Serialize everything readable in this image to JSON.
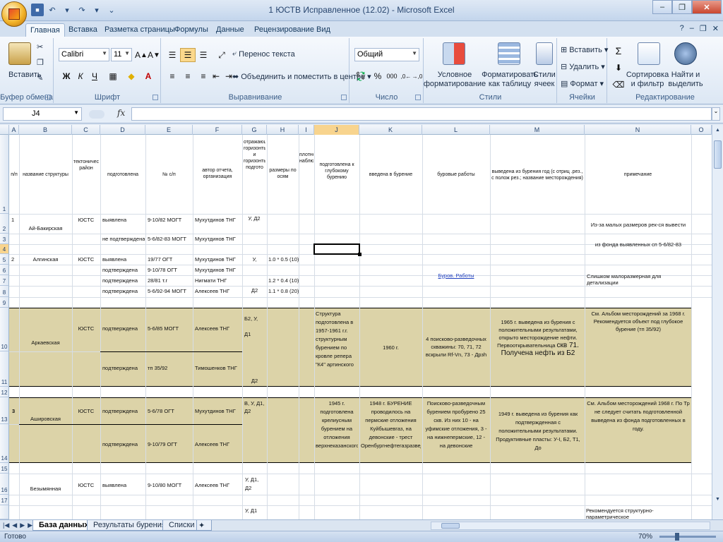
{
  "window": {
    "title": "1 ЮСТВ Исправленное (12.02) - Microsoft Excel"
  },
  "ribbon_tabs": [
    "Главная",
    "Вставка",
    "Разметка страницы",
    "Формулы",
    "Данные",
    "Рецензирование",
    "Вид"
  ],
  "ribbon": {
    "clipboard": {
      "label": "Буфер обмена",
      "paste": "Вставить"
    },
    "font": {
      "label": "Шрифт",
      "name": "Calibri",
      "size": "11",
      "bold": "Ж",
      "italic": "К",
      "underline": "Ч"
    },
    "alignment": {
      "label": "Выравнивание",
      "wrap": "Перенос текста",
      "merge": "Объединить и поместить в центре"
    },
    "number": {
      "label": "Число",
      "format": "Общий",
      "percent": "%",
      "thousands": "000"
    },
    "styles": {
      "label": "Стили",
      "conditional": "Условное форматирование",
      "as_table": "Форматировать как таблицу",
      "cell_styles": "Стили ячеек"
    },
    "cells": {
      "label": "Ячейки",
      "insert": "Вставить",
      "delete": "Удалить",
      "format": "Формат"
    },
    "editing": {
      "label": "Редактирование",
      "sort": "Сортировка и фильтр",
      "find": "Найти и выделить"
    }
  },
  "formula_bar": {
    "name_box": "J4",
    "fx": "fx",
    "value": ""
  },
  "columns": [
    "A",
    "B",
    "C",
    "D",
    "E",
    "F",
    "G",
    "H",
    "I",
    "J",
    "K",
    "L",
    "M",
    "N",
    "O"
  ],
  "rows": [
    "1",
    "2",
    "3",
    "4",
    "5",
    "6",
    "7",
    "8",
    "9",
    "10",
    "11",
    "12",
    "13",
    "14",
    "15",
    "16",
    "17"
  ],
  "headers": {
    "a": "п/п",
    "b": "название структуры",
    "c": "тектонический район",
    "d": "подготовлена",
    "e": "№ с/п",
    "f": "автор отчета, организация",
    "g": "отражающие горизонты и горизонты подгото",
    "h": "размеры по осям",
    "i": "плотность наблюдений",
    "j": "подготовлена к глубокому бурению",
    "k": "введена в бурение",
    "l": "буровые работы",
    "m": "выведена из бурения год (с отриц .рез., с полож рез.; название месторождения)",
    "n": "примечание"
  },
  "cells": {
    "r2_a": "1",
    "r2_b": "Ай-Бакирская",
    "r2_c": "ЮСТС",
    "r2_d": "выявлена",
    "r2_e": "9-10/82 МОГТ",
    "r2_f": "Мухутдинов ТНГ",
    "r2_g": "У, Д2",
    "r2_n": "Из-за малых размеров рек-ся вывести из фонда выявленных сп 5-6/82-83",
    "r3_d": "не подтверждена",
    "r3_e": "5-6/82-83 МОГТ",
    "r3_f": "Мухутдинов ТНГ",
    "r5_a": "2",
    "r5_b": "Алгинская",
    "r5_c": "ЮСТС",
    "r5_d": "выявлена",
    "r5_e": "19/77 ОГТ",
    "r5_f": "Мухутдинов ТНГ",
    "r5_g": "У,",
    "r5_h": "1.0 * 0.5 (10)",
    "r6_d": "подтверждена",
    "r6_e": "9-10/78 ОГТ",
    "r6_f": "Мухутдинов ТНГ",
    "r6_l": "Буров. Работы",
    "r7_d": "подтверждена",
    "r7_e": "28/81 т.г",
    "r7_f": "Нигмати ТНГ",
    "r7_g": "Д2",
    "r7_h": "1.2 * 0.4 (10)",
    "r8_d": "подтверждена",
    "r8_e": "5-6/92-94 МОГТ",
    "r8_f": "Алексеев ТНГ",
    "r8_h": "1.1 * 0.8 (20)",
    "r6_n": "Слишком малоразмерная для детализации",
    "r10_b": "Аркаевская",
    "r10_c": "ЮСТС",
    "r10_d": "подтверждена",
    "r10_e": "5-6/85 МОГТ",
    "r10_f": "Алексеев ТНГ",
    "r10_g": "Б2, У, Д1",
    "r10_j": "Структура подготовлена в 1957-1961 г.г. структурным бурением по кровле репера \"К4\" артинского",
    "r10_k": "1960 г.",
    "r10_l": "4 поисково-разведочных скважины: 70, 71, 72 вскрыли Rf-Vn, 73 - Дрзh",
    "r10_m": "1965 г. выведена из бурения с положительными результатами, открыто месторождение нефти. Первооткрывательница",
    "r10_m_well": "скв 71.",
    "r10_m_oil": "Получена нефть из Б2",
    "r10_n": "См. Альбом месторождений за 1968 г. Рекомендуется объект под глубокое бурение (тп 35/92)",
    "r11_d": "подтверждена",
    "r11_e": "тп 35/92",
    "r11_f": "Тимошенков ТНГ",
    "r11_g": "Д2",
    "r13_a": "3",
    "r13_b": "Аширoвская",
    "r13_c": "ЮСТС",
    "r13_d": "подтверждена",
    "r13_e": "5-6/78 ОГТ",
    "r13_f": "Мухутдинов ТНГ",
    "r13_g": "В, У, Д1, Д2",
    "r13_j": "1945 г. подготовлена крелиусным бурением на отложения верхнеказанского",
    "r13_k": "1948 г. БУРЕНИЕ проводилось на пермские отложения Куйбышевгаз, на девонские - трест Оренбургнефтегазразведка",
    "r13_l": "Поисково-разведочным бурением пробурено 25 скв. Из них 10 - на уфимские отложения, 3 - на нижнепермские, 12 - на девонские",
    "r13_m": "1949 г. выведена из бурения как подтвержденная с положительными результатами. Продуктивные пласты: У-I, Б2, Т1, До",
    "r13_n": "См. Альбом месторождений 1968 г. По Тр не следует считать подготовленной выведена из фонда подготовленных в году.",
    "r14_d": "подтверждена",
    "r14_e": "9-10/79 ОГТ",
    "r14_f": "Алексеев ТНГ",
    "r16_b": "Безымянная",
    "r16_c": "ЮСТС",
    "r16_d": "выявлена",
    "r16_e": "9-10/80 МОГТ",
    "r16_f": "Алексеев ТНГ",
    "r16_g": "У, Д1, Д2",
    "r18_g": "У, Д1",
    "r18_n": "Рекомендуется структурно-параметрическое"
  },
  "sheets": [
    "База данных",
    "Результаты бурения",
    "Списки"
  ],
  "status": {
    "ready": "Готово",
    "zoom": "70%"
  }
}
